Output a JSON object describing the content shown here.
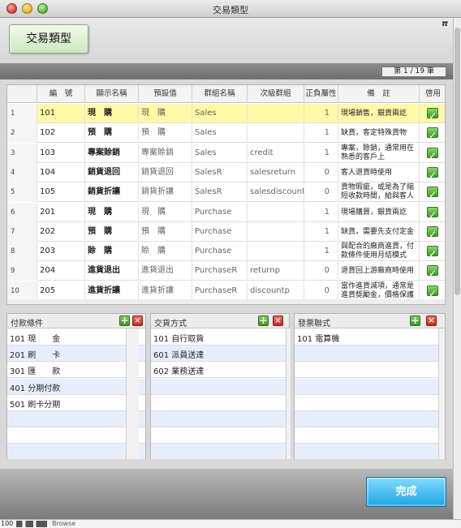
{
  "window": {
    "title": "交易類型"
  },
  "header": {
    "type_button": "交易類型",
    "pi_symbol": "π"
  },
  "pager": {
    "text": "第 1 / 19 筆"
  },
  "table": {
    "columns": [
      "",
      "編　號",
      "顯示名稱",
      "預設值",
      "群組名稱",
      "次級群組",
      "正負屬性",
      "備　註",
      "啓用"
    ],
    "rows": [
      {
        "no": "1",
        "code": "101",
        "display": "現　購",
        "default": "現　購",
        "group": "Sales",
        "subgroup": "",
        "sign": "1",
        "note": "現場銷售，銀貨兩訖",
        "enabled": true
      },
      {
        "no": "2",
        "code": "102",
        "display": "預　購",
        "default": "預　購",
        "group": "Sales",
        "subgroup": "",
        "sign": "1",
        "note": "缺貨，客定特殊貨物",
        "enabled": true
      },
      {
        "no": "3",
        "code": "103",
        "display": "專案賒銷",
        "default": "專案賒銷",
        "group": "Sales",
        "subgroup": "credit",
        "sign": "1",
        "note": "專案，賒銷，通常用在熟悉的客戶上",
        "enabled": true
      },
      {
        "no": "4",
        "code": "104",
        "display": "銷貨退回",
        "default": "銷貨退回",
        "group": "SalesR",
        "subgroup": "salesreturn",
        "sign": "0",
        "note": "客人退貨時使用",
        "enabled": true
      },
      {
        "no": "5",
        "code": "105",
        "display": "銷貨折讓",
        "default": "銷貨折讓",
        "group": "SalesR",
        "subgroup": "salesdiscount",
        "sign": "0",
        "note": "貨物瑕疵，或是為了縮短收款時間，給與客人",
        "enabled": true
      },
      {
        "no": "6",
        "code": "201",
        "display": "現　購",
        "default": "現　購",
        "group": "Purchase",
        "subgroup": "",
        "sign": "1",
        "note": "現場購買，銀貨兩訖",
        "enabled": true
      },
      {
        "no": "7",
        "code": "202",
        "display": "預　購",
        "default": "預　購",
        "group": "Purchase",
        "subgroup": "",
        "sign": "1",
        "note": "缺貨，需要先支付定金",
        "enabled": true
      },
      {
        "no": "8",
        "code": "203",
        "display": "賒　購",
        "default": "賒　購",
        "group": "Purchase",
        "subgroup": "",
        "sign": "1",
        "note": "與配合的廠商進貨，付款條件使用月結模式",
        "enabled": true
      },
      {
        "no": "9",
        "code": "204",
        "display": "進貨退出",
        "default": "進貨退出",
        "group": "PurchaseR",
        "subgroup": "returnp",
        "sign": "0",
        "note": "退貨回上游廠商時使用",
        "enabled": true
      },
      {
        "no": "10",
        "code": "205",
        "display": "進貨折讓",
        "default": "進貨折讓",
        "group": "PurchaseR",
        "subgroup": "discountp",
        "sign": "0",
        "note": "當作進貨減項，通常是進貨獎勵金，價格保護",
        "enabled": true
      }
    ]
  },
  "panels": {
    "payment": {
      "title": "付款條件",
      "items": [
        "101 現　　金",
        "201 刷　　卡",
        "301 匯　　款",
        "401 分期付款",
        "501 刷卡分期"
      ]
    },
    "delivery": {
      "title": "交貨方式",
      "items": [
        "101 自行取貨",
        "601 派員送達",
        "602 業務送達"
      ]
    },
    "invoice": {
      "title": "發票聯式",
      "items": [
        "101 電算機"
      ]
    }
  },
  "footer": {
    "done_label": "完成"
  },
  "status": {
    "zoom": "100",
    "mode": "Browse"
  }
}
